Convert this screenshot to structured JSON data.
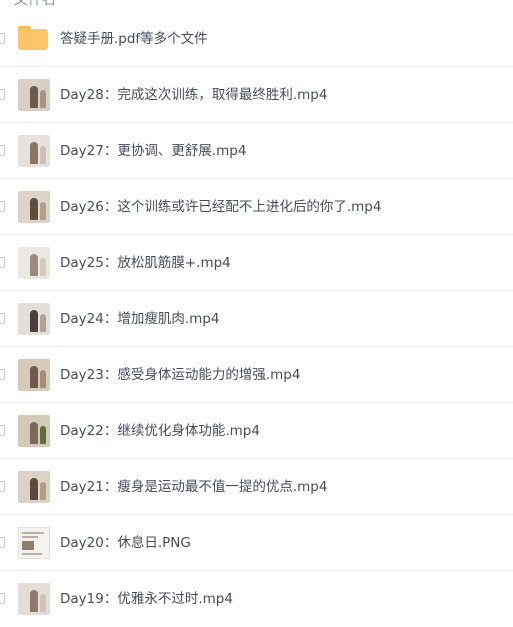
{
  "header": {
    "partial_text": "文件名"
  },
  "files": [
    {
      "name": "答疑手册.pdf等多个文件",
      "icon": "folder-icon",
      "thumb": "folder"
    },
    {
      "name": "Day28：完成这次训练，取得最终胜利.mp4",
      "icon": "video-thumbnail",
      "thumb": "video",
      "bg": "#d9cfc4",
      "fig": "#6b5a4d",
      "fig2": "#a89484"
    },
    {
      "name": "Day27：更协调、更舒展.mp4",
      "icon": "video-thumbnail",
      "thumb": "video",
      "bg": "#e6e1da",
      "fig": "#8a7565",
      "fig2": "#cbbfb2"
    },
    {
      "name": "Day26：这个训练或许已经配不上进化后的你了.mp4",
      "icon": "video-thumbnail",
      "thumb": "video",
      "bg": "#ddd3c6",
      "fig": "#5e4c40",
      "fig2": "#b39e88"
    },
    {
      "name": "Day25：放松肌筋膜+.mp4",
      "icon": "video-thumbnail",
      "thumb": "video",
      "bg": "#ece9e3",
      "fig": "#9c8a7a",
      "fig2": "#d5cabd"
    },
    {
      "name": "Day24：增加瘦肌肉.mp4",
      "icon": "video-thumbnail",
      "thumb": "video",
      "bg": "#e4e0d9",
      "fig": "#4a3f38",
      "fig2": "#b0a396"
    },
    {
      "name": "Day23：感受身体运动能力的增强.mp4",
      "icon": "video-thumbnail",
      "thumb": "video",
      "bg": "#d6cabb",
      "fig": "#6e5a49",
      "fig2": "#a48c76"
    },
    {
      "name": "Day22：继续优化身体功能.mp4",
      "icon": "video-thumbnail",
      "thumb": "video",
      "bg": "#d2c9b9",
      "fig": "#7a6a58",
      "fig2": "#5a6e3e"
    },
    {
      "name": "Day21：瘦身是运动最不值一提的优点.mp4",
      "icon": "video-thumbnail",
      "thumb": "video",
      "bg": "#dcd2c6",
      "fig": "#5c4a3e",
      "fig2": "#b29c86"
    },
    {
      "name": "Day20：休息日.PNG",
      "icon": "image-thumbnail",
      "thumb": "doc"
    },
    {
      "name": "Day19：优雅永不过时.mp4",
      "icon": "video-thumbnail",
      "thumb": "video",
      "bg": "#e3ddd5",
      "fig": "#8e7a6a",
      "fig2": "#cfc2b4"
    }
  ]
}
